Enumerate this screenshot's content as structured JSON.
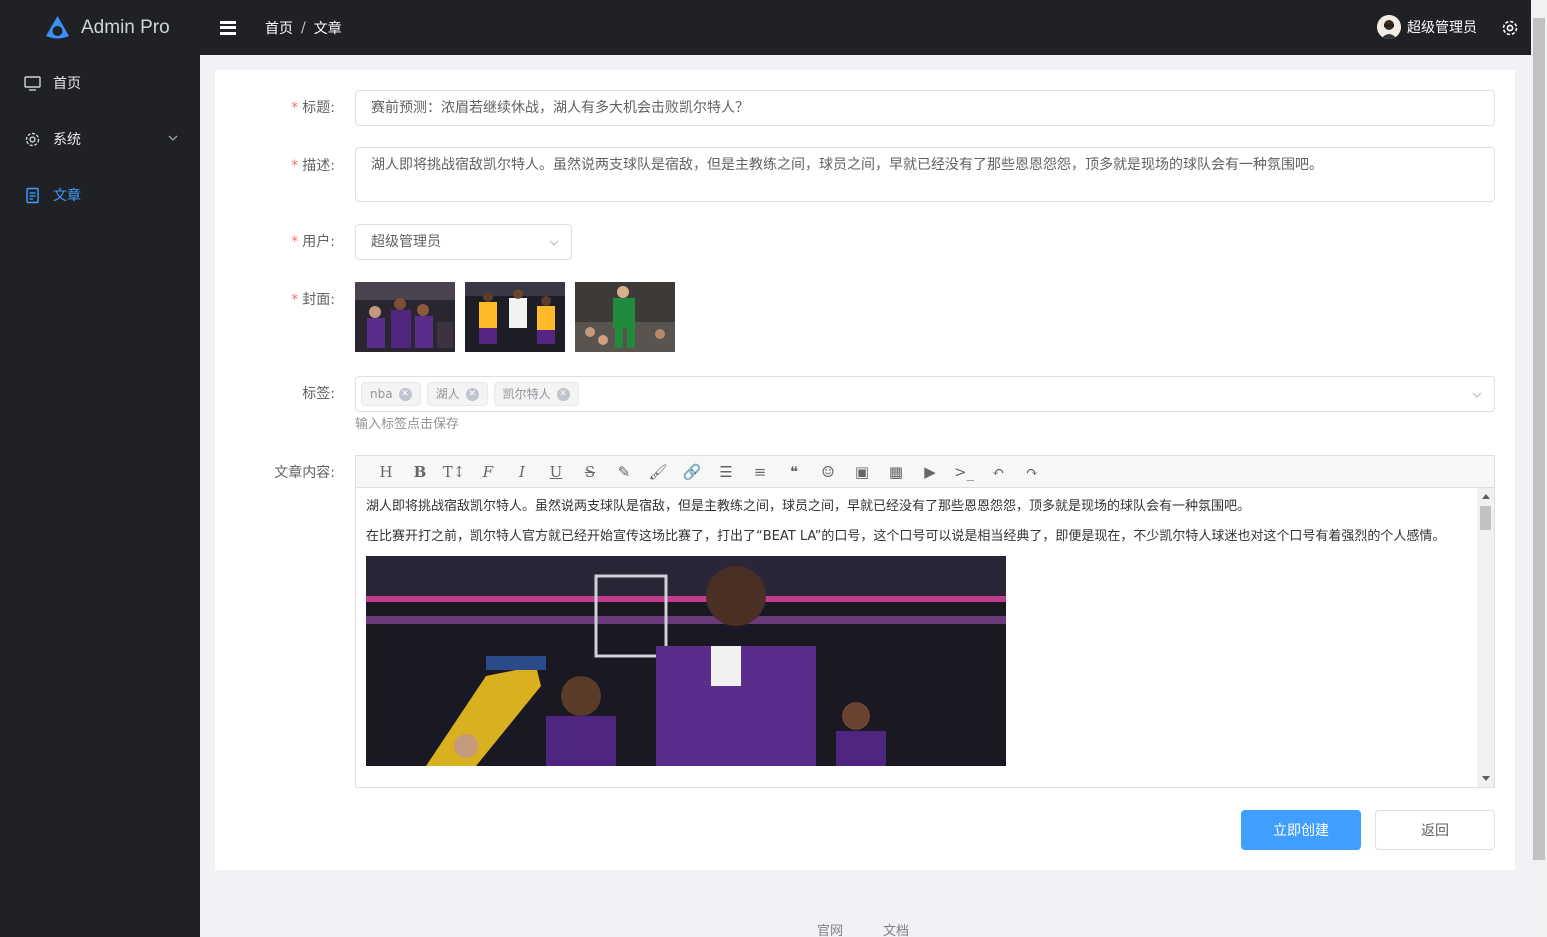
{
  "app": {
    "name": "Admin Pro"
  },
  "sidebar": {
    "items": [
      {
        "label": "首页",
        "icon": "monitor-icon",
        "active": false
      },
      {
        "label": "系统",
        "icon": "gear-icon",
        "active": false,
        "expandable": true
      },
      {
        "label": "文章",
        "icon": "document-icon",
        "active": true
      }
    ]
  },
  "header": {
    "breadcrumb": [
      "首页",
      "文章"
    ],
    "breadcrumb_sep": "/",
    "user_name": "超级管理员"
  },
  "form": {
    "title": {
      "label": "标题:",
      "required": true,
      "value": "赛前预测：浓眉若继续休战，湖人有多大机会击败凯尔特人？"
    },
    "description": {
      "label": "描述:",
      "required": true,
      "value": "湖人即将挑战宿敌凯尔特人。虽然说两支球队是宿敌，但是主教练之间，球员之间，早就已经没有了那些恩恩怨怨，顶多就是现场的球队会有一种氛围吧。"
    },
    "user": {
      "label": "用户:",
      "required": true,
      "value": "超级管理员"
    },
    "cover": {
      "label": "封面:",
      "required": true,
      "images": [
        "lakers-team-photo",
        "lakers-bench-photo",
        "celtics-player-photo"
      ]
    },
    "tags": {
      "label": "标签:",
      "required": false,
      "items": [
        "nba",
        "湖人",
        "凯尔特人"
      ],
      "hint": "输入标签点击保存"
    },
    "content": {
      "label": "文章内容:",
      "required": false,
      "toolbar": [
        "heading-icon",
        "bold-icon",
        "text-size-icon",
        "font-icon",
        "italic-icon",
        "underline-icon",
        "strikethrough-icon",
        "highlighter-icon",
        "brush-icon",
        "link-icon",
        "list-icon",
        "align-icon",
        "quote-icon",
        "emoji-icon",
        "image-icon",
        "table-icon",
        "video-icon",
        "code-icon",
        "undo-icon",
        "redo-icon"
      ],
      "paragraphs": [
        "湖人即将挑战宿敌凯尔特人。虽然说两支球队是宿敌，但是主教练之间，球员之间，早就已经没有了那些恩恩怨怨，顶多就是现场的球队会有一种氛围吧。",
        "在比赛开打之前，凯尔特人官方就已经开始宣传这场比赛了，打出了“BEAT LA”的口号，这个口号可以说是相当经典了，即便是现在，不少凯尔特人球迷也对这个口号有着强烈的个人感情。"
      ]
    },
    "submit_label": "立即创建",
    "back_label": "返回"
  },
  "footer": {
    "links": [
      "官网",
      "文档"
    ]
  },
  "colors": {
    "accent": "#409eff",
    "sidebar_bg": "#1f2125",
    "required": "#f56c6c"
  }
}
